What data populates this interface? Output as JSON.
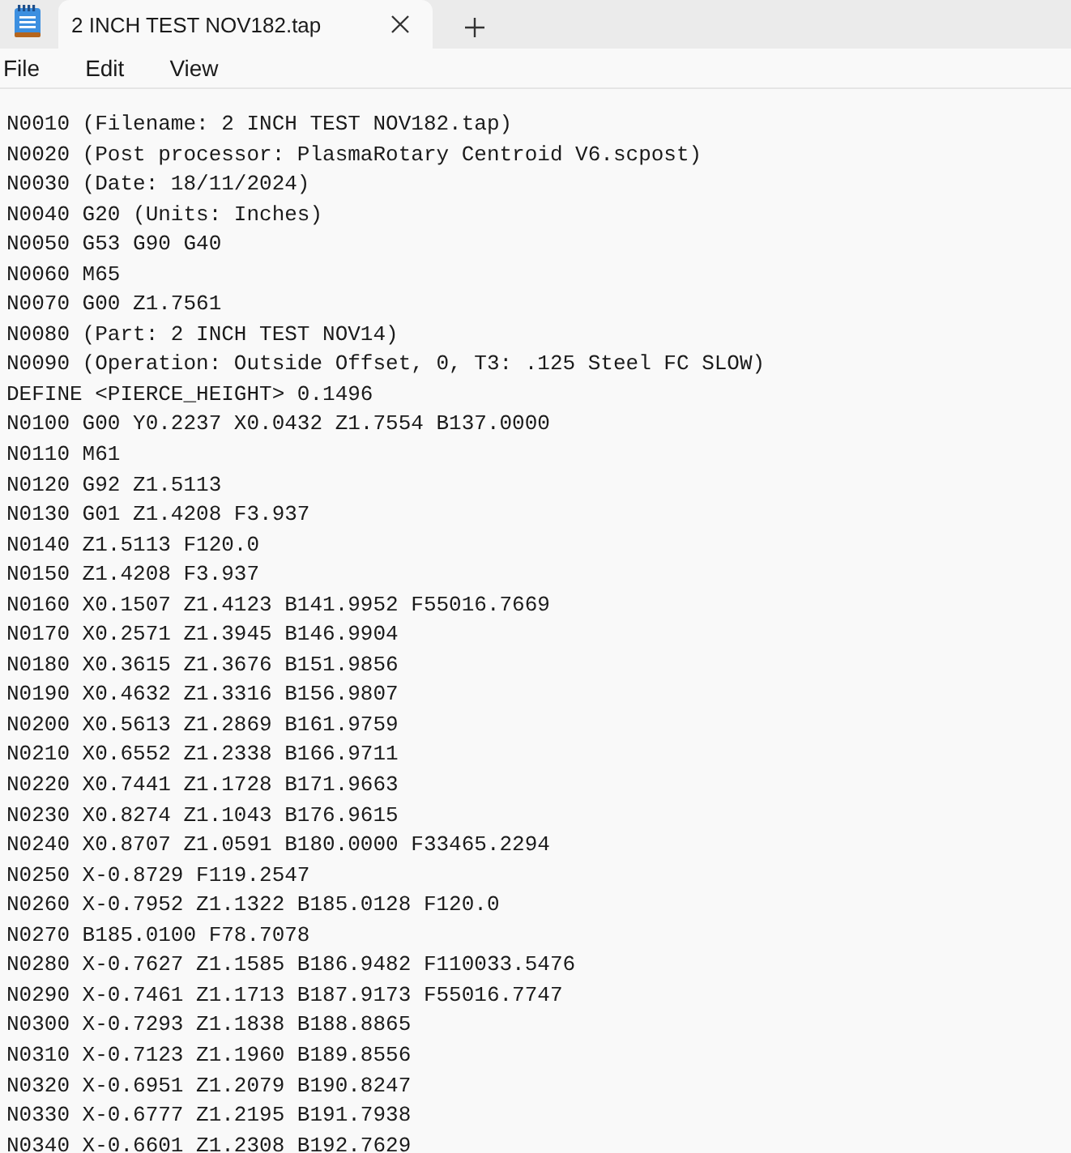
{
  "tabs": [
    {
      "title": "2 INCH TEST NOV182.tap",
      "selected": true
    }
  ],
  "menu": [
    "File",
    "Edit",
    "View"
  ],
  "lines": [
    "N0010 (Filename: 2 INCH TEST NOV182.tap)",
    "N0020 (Post processor: PlasmaRotary Centroid V6.scpost)",
    "N0030 (Date: 18/11/2024)",
    "N0040 G20 (Units: Inches)",
    "N0050 G53 G90 G40",
    "N0060 M65",
    "N0070 G00 Z1.7561",
    "N0080 (Part: 2 INCH TEST NOV14)",
    "N0090 (Operation: Outside Offset, 0, T3: .125 Steel FC SLOW)",
    "DEFINE <PIERCE_HEIGHT> 0.1496",
    "N0100 G00 Y0.2237 X0.0432 Z1.7554 B137.0000",
    "N0110 M61",
    "N0120 G92 Z1.5113",
    "N0130 G01 Z1.4208 F3.937",
    "N0140 Z1.5113 F120.0",
    "N0150 Z1.4208 F3.937",
    "N0160 X0.1507 Z1.4123 B141.9952 F55016.7669",
    "N0170 X0.2571 Z1.3945 B146.9904",
    "N0180 X0.3615 Z1.3676 B151.9856",
    "N0190 X0.4632 Z1.3316 B156.9807",
    "N0200 X0.5613 Z1.2869 B161.9759",
    "N0210 X0.6552 Z1.2338 B166.9711",
    "N0220 X0.7441 Z1.1728 B171.9663",
    "N0230 X0.8274 Z1.1043 B176.9615",
    "N0240 X0.8707 Z1.0591 B180.0000 F33465.2294",
    "N0250 X-0.8729 F119.2547",
    "N0260 X-0.7952 Z1.1322 B185.0128 F120.0",
    "N0270 B185.0100 F78.7078",
    "N0280 X-0.7627 Z1.1585 B186.9482 F110033.5476",
    "N0290 X-0.7461 Z1.1713 B187.9173 F55016.7747",
    "N0300 X-0.7293 Z1.1838 B188.8865",
    "N0310 X-0.7123 Z1.1960 B189.8556",
    "N0320 X-0.6951 Z1.2079 B190.8247",
    "N0330 X-0.6777 Z1.2195 B191.7938",
    "N0340 X-0.6601 Z1.2308 B192.7629"
  ]
}
